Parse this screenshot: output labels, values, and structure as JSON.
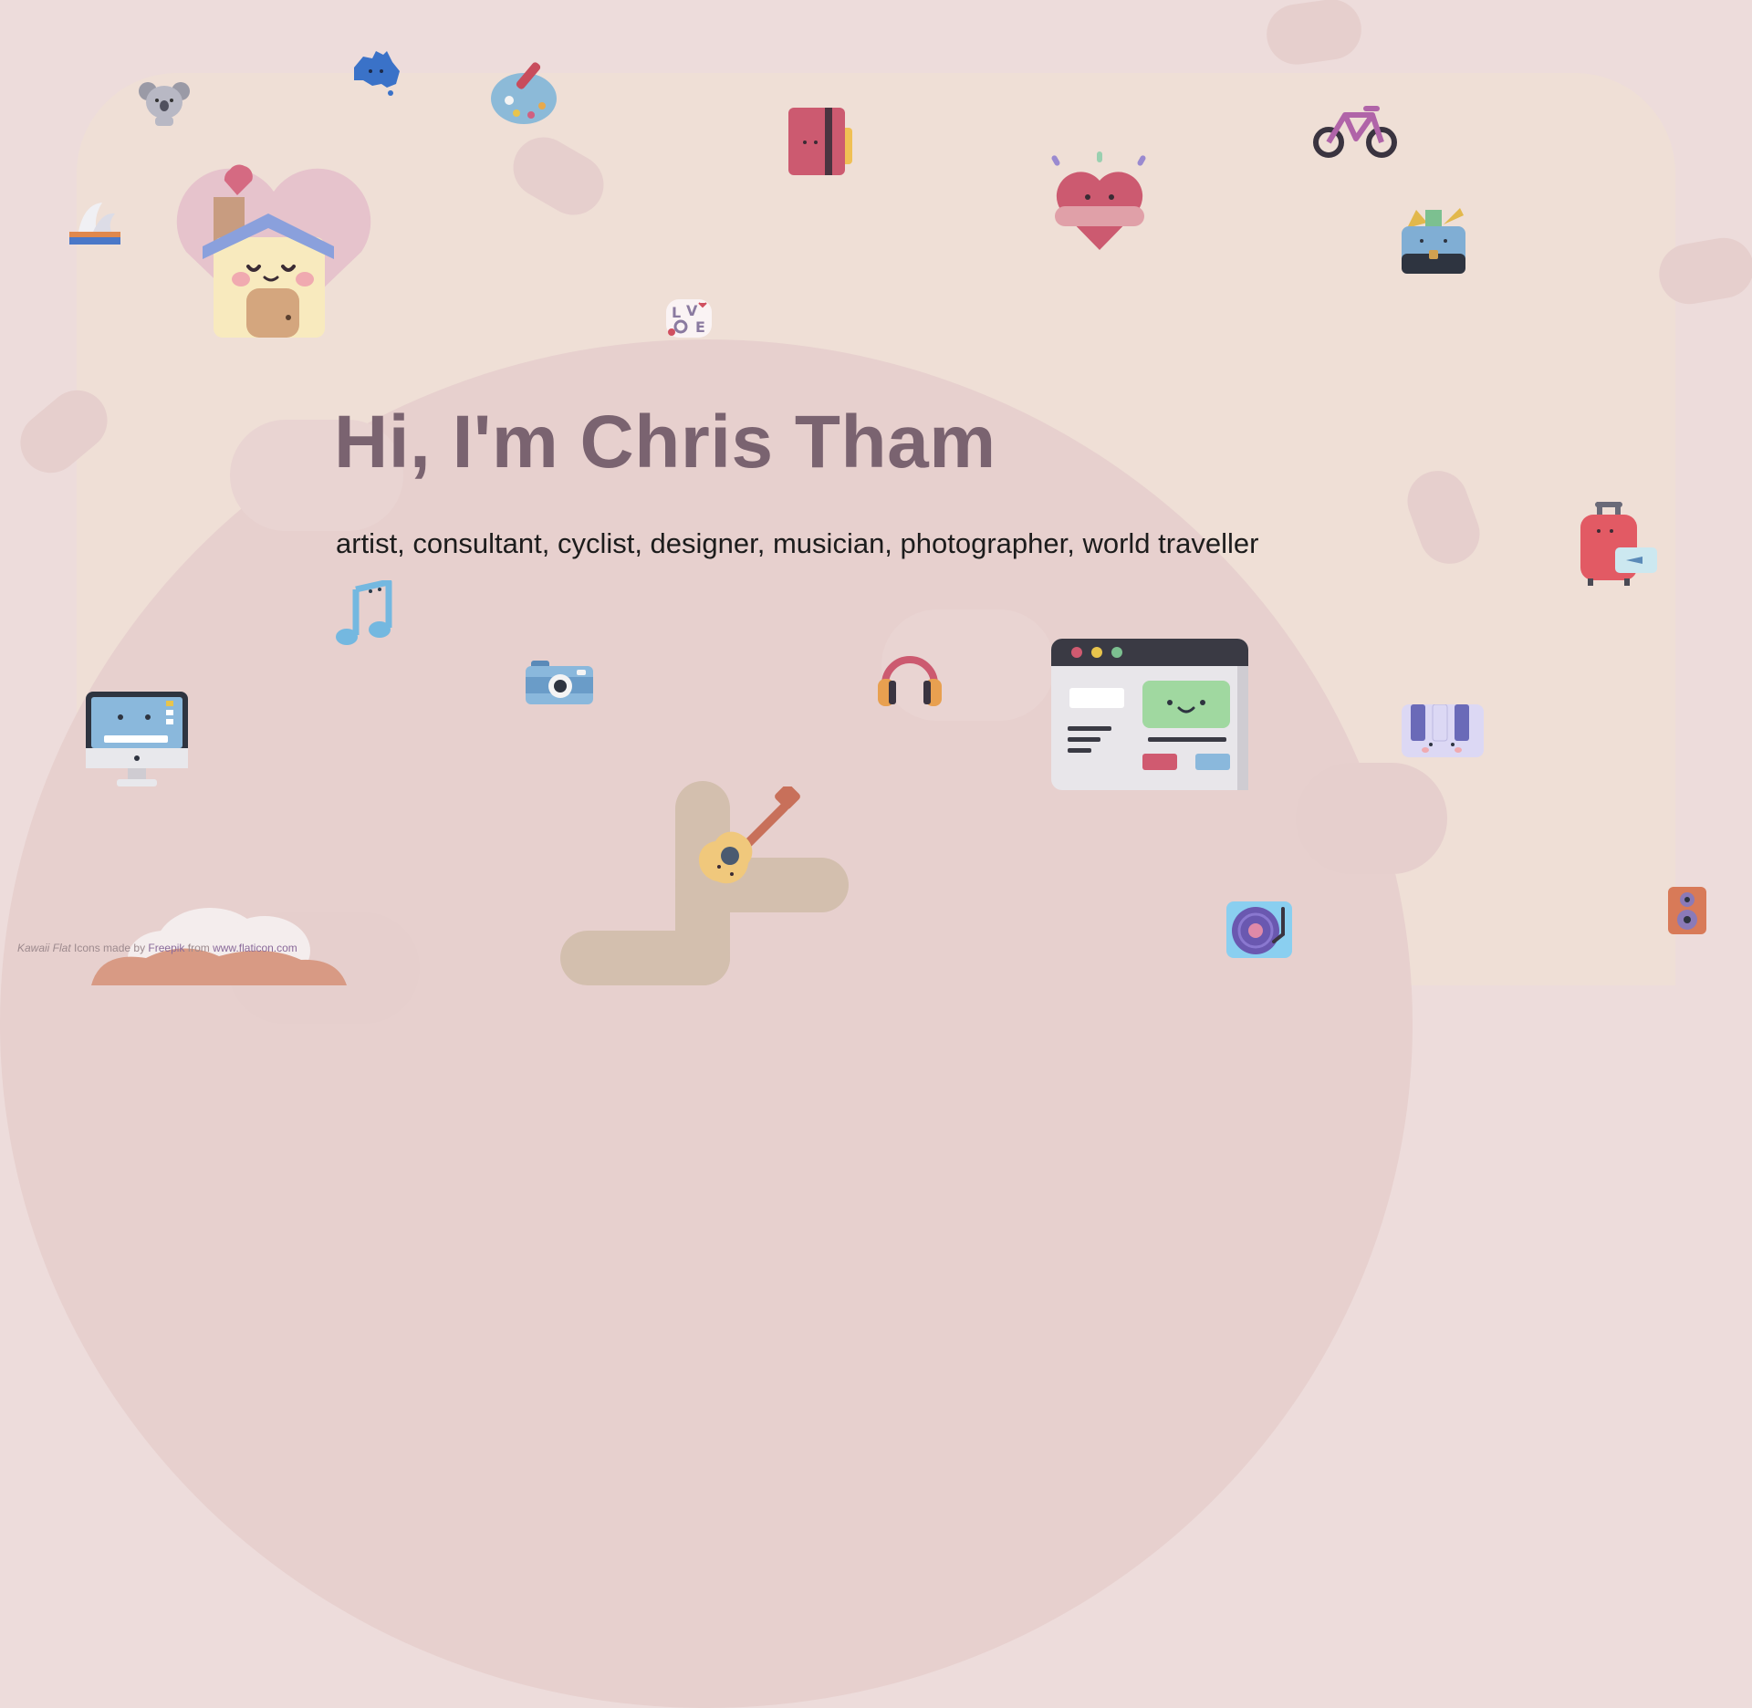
{
  "hero": {
    "title": "Hi, I'm Chris Tham",
    "subtitle": "artist, consultant, cyclist, designer, musician, photographer, world traveller"
  },
  "credit": {
    "icon_set": "Kawaii Flat",
    "text_1": " Icons made by ",
    "author": "Freepik",
    "text_2": " from ",
    "site": "www.flaticon.com"
  },
  "colors": {
    "background": "#eddcdb",
    "title": "#7a6370",
    "subtitle": "#1c1c1c",
    "link": "#8a6a9a"
  },
  "icons": [
    "koala-icon",
    "australia-map-icon",
    "paint-palette-icon",
    "notebook-icon",
    "heart-hug-icon",
    "bicycle-icon",
    "sydney-opera-house-icon",
    "house-heart-icon",
    "briefcase-icon",
    "love-sticker-icon",
    "music-note-icon",
    "camera-icon",
    "headphones-icon",
    "browser-window-icon",
    "suitcase-icon",
    "computer-monitor-icon",
    "keyboard-icon",
    "guitar-icon",
    "vinyl-record-icon",
    "speaker-icon",
    "cloud-icon",
    "tree-icon"
  ]
}
